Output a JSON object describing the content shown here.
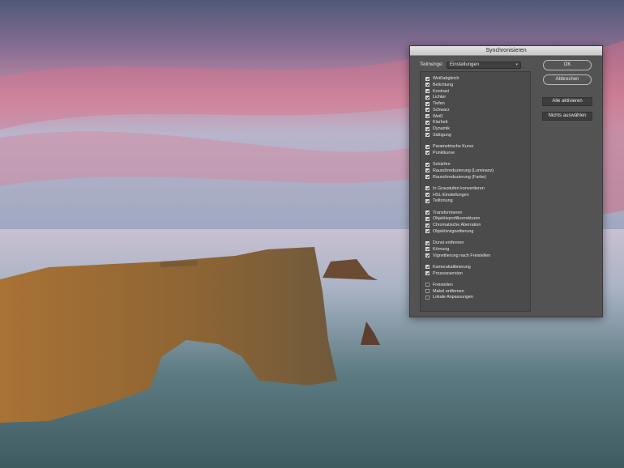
{
  "dialog": {
    "title": "Synchronisieren",
    "subset_label": "Teilmenge:",
    "subset_value": "Einstellungen",
    "buttons": {
      "ok": "OK",
      "cancel": "Abbrechen",
      "select_all": "Alle aktivieren",
      "select_none": "Nichts auswählen"
    },
    "groups": [
      {
        "items": [
          {
            "label": "Weißabgleich",
            "checked": true
          },
          {
            "label": "Belichtung",
            "checked": true
          },
          {
            "label": "Kontrast",
            "checked": true
          },
          {
            "label": "Lichter",
            "checked": true
          },
          {
            "label": "Tiefen",
            "checked": true
          },
          {
            "label": "Schwarz",
            "checked": true
          },
          {
            "label": "Weiß",
            "checked": true
          },
          {
            "label": "Klarheit",
            "checked": true
          },
          {
            "label": "Dynamik",
            "checked": true
          },
          {
            "label": "Sättigung",
            "checked": true
          }
        ]
      },
      {
        "items": [
          {
            "label": "Parametrische Kurve",
            "checked": true
          },
          {
            "label": "Punktkurve",
            "checked": true
          }
        ]
      },
      {
        "items": [
          {
            "label": "Schärfen",
            "checked": true
          },
          {
            "label": "Rauschreduzierung (Luminanz)",
            "checked": true
          },
          {
            "label": "Rauschreduzierung (Farbe)",
            "checked": true
          }
        ]
      },
      {
        "items": [
          {
            "label": "In Graustufen konvertieren",
            "checked": true
          },
          {
            "label": "HSL-Einstellungen",
            "checked": true
          },
          {
            "label": "Teiltonung",
            "checked": true
          }
        ]
      },
      {
        "items": [
          {
            "label": "Transformieren",
            "checked": true
          },
          {
            "label": "Objektivprofilkorrekturen",
            "checked": true
          },
          {
            "label": "Chromatische Aberration",
            "checked": true
          },
          {
            "label": "Objektivvignettierung",
            "checked": true
          }
        ]
      },
      {
        "items": [
          {
            "label": "Dunst entfernen",
            "checked": true
          },
          {
            "label": "Körnung",
            "checked": true
          },
          {
            "label": "Vignettierung nach Freistellen",
            "checked": true
          }
        ]
      },
      {
        "items": [
          {
            "label": "Kamerakalibrierung",
            "checked": true
          },
          {
            "label": "Prozessversion",
            "checked": true
          }
        ]
      },
      {
        "items": [
          {
            "label": "Freistellen",
            "checked": false
          },
          {
            "label": "Makel entfernen",
            "checked": false
          },
          {
            "label": "Lokale Anpassungen",
            "checked": false
          }
        ]
      }
    ]
  },
  "colors": {
    "dialog_bg": "#535353",
    "sky_top": "#4f5775",
    "sky_pink": "#d9708a",
    "sea": "#4f6e72",
    "rock": "#9a6a35"
  }
}
